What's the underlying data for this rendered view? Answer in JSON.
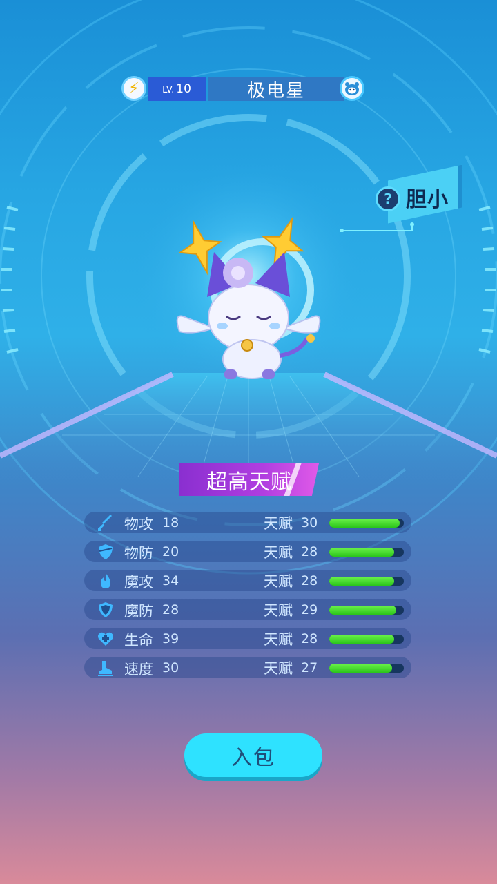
{
  "header": {
    "level_prefix": "LV.",
    "level": "10",
    "pet_name": "极电星",
    "energy_icon": "lightning-icon",
    "pet_icon": "pet-face-icon"
  },
  "personality": {
    "mark": "?",
    "label": "胆小"
  },
  "talent_grade": "超高天赋",
  "stats": [
    {
      "icon": "sword-icon",
      "name": "物攻",
      "value": "18",
      "talent_label": "天赋",
      "talent": "30",
      "fill": 0.94
    },
    {
      "icon": "shield-icon",
      "name": "物防",
      "value": "20",
      "talent_label": "天赋",
      "talent": "28",
      "fill": 0.87
    },
    {
      "icon": "flame-icon",
      "name": "魔攻",
      "value": "34",
      "talent_label": "天赋",
      "talent": "28",
      "fill": 0.87
    },
    {
      "icon": "magic-shield-icon",
      "name": "魔防",
      "value": "28",
      "talent_label": "天赋",
      "talent": "29",
      "fill": 0.9
    },
    {
      "icon": "heart-plus-icon",
      "name": "生命",
      "value": "39",
      "talent_label": "天赋",
      "talent": "28",
      "fill": 0.87
    },
    {
      "icon": "boot-icon",
      "name": "速度",
      "value": "30",
      "talent_label": "天赋",
      "talent": "27",
      "fill": 0.84
    }
  ],
  "actions": {
    "add_to_bag": "入包"
  },
  "colors": {
    "bar_fill": "#2bc41a",
    "button": "#2ee2ff",
    "banner": "#b03ee0"
  }
}
